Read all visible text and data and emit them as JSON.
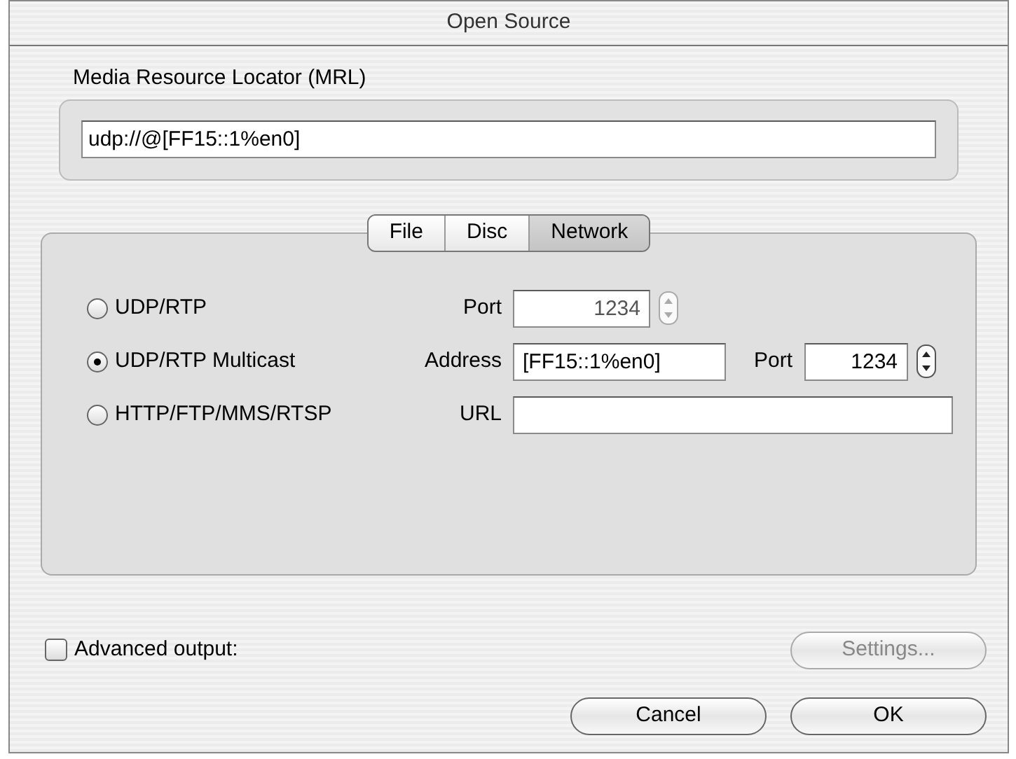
{
  "window": {
    "title": "Open Source"
  },
  "mrl": {
    "label": "Media Resource Locator (MRL)",
    "value": "udp://@[FF15::1%en0]"
  },
  "tabs": [
    {
      "label": "File",
      "selected": false
    },
    {
      "label": "Disc",
      "selected": false
    },
    {
      "label": "Network",
      "selected": true
    }
  ],
  "options": [
    {
      "label": "UDP/RTP",
      "selected": false,
      "fields": [
        {
          "kind": "number",
          "label": "Port",
          "value": "1234",
          "disabled": true
        }
      ]
    },
    {
      "label": "UDP/RTP Multicast",
      "selected": true,
      "fields": [
        {
          "kind": "text",
          "label": "Address",
          "value": "[FF15::1%en0]",
          "disabled": false
        },
        {
          "kind": "number",
          "label": "Port",
          "value": "1234",
          "disabled": false
        }
      ]
    },
    {
      "label": "HTTP/FTP/MMS/RTSP",
      "selected": false,
      "fields": [
        {
          "kind": "wide",
          "label": "URL"
        }
      ]
    }
  ],
  "advanced": {
    "label": "Advanced output:",
    "checked": false
  },
  "settings_button": {
    "label": "Settings...",
    "disabled": true
  },
  "buttons": [
    "Cancel",
    "OK"
  ]
}
